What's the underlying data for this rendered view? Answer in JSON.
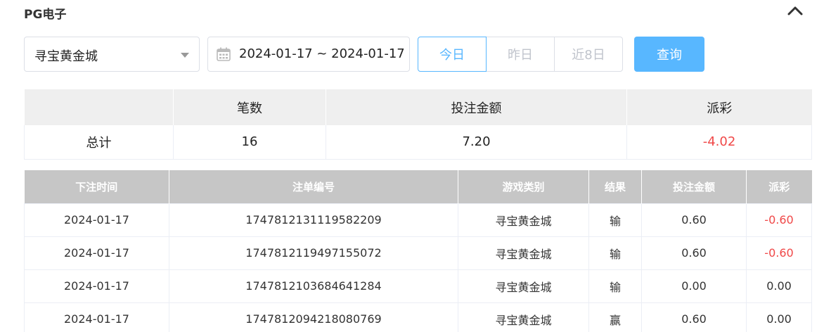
{
  "header": {
    "title": "PG电子"
  },
  "filters": {
    "game_select": "寻宝黄金城",
    "date_range": "2024-01-17 ~ 2024-01-17",
    "quick": [
      "今日",
      "昨日",
      "近8日"
    ],
    "query_label": "查询"
  },
  "summary": {
    "headers": [
      "",
      "笔数",
      "投注金额",
      "派彩"
    ],
    "row": {
      "label": "总计",
      "count": "16",
      "bet": "7.20",
      "payout": "-4.02"
    }
  },
  "records": {
    "headers": [
      "下注时间",
      "注单编号",
      "游戏类别",
      "结果",
      "投注金额",
      "派彩"
    ],
    "rows": [
      {
        "time": "2024-01-17",
        "id": "1747812131119582209",
        "game": "寻宝黄金城",
        "result": "输",
        "bet": "0.60",
        "payout": "-0.60"
      },
      {
        "time": "2024-01-17",
        "id": "1747812119497155072",
        "game": "寻宝黄金城",
        "result": "输",
        "bet": "0.60",
        "payout": "-0.60"
      },
      {
        "time": "2024-01-17",
        "id": "1747812103684641284",
        "game": "寻宝黄金城",
        "result": "输",
        "bet": "0.00",
        "payout": "0.00"
      },
      {
        "time": "2024-01-17",
        "id": "1747812094218080769",
        "game": "寻宝黄金城",
        "result": "赢",
        "bet": "0.60",
        "payout": "0.00"
      }
    ]
  },
  "colors": {
    "accent": "#58b7ff",
    "negative": "#f04848",
    "header_gray": "#c6c6c6"
  }
}
